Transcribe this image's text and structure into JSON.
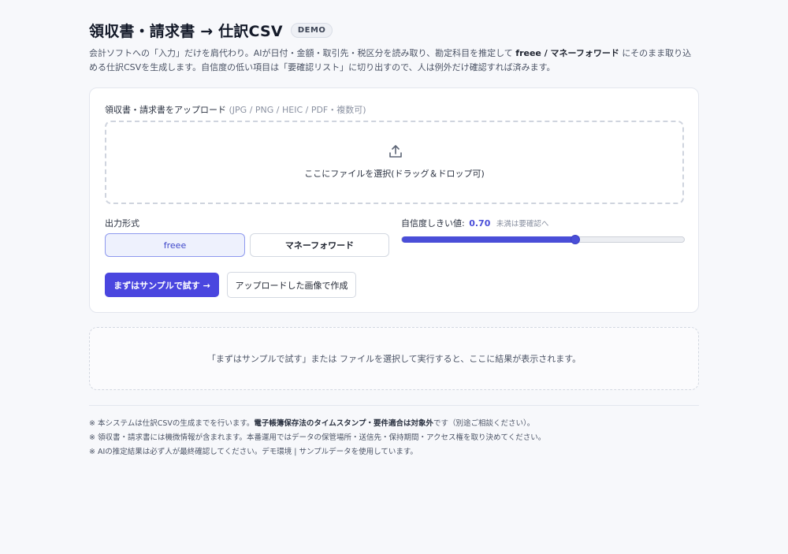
{
  "header": {
    "title": "領収書・請求書 → 仕訳CSV",
    "badge": "DEMO",
    "desc_1": "会計ソフトへの「入力」だけを肩代わり。AIが日付・金額・取引先・税区分を読み取り、勘定科目を推定して ",
    "desc_bold": "freee / マネーフォワード",
    "desc_2": " にそのまま取り込める仕訳CSVを生成します。自信度の低い項目は「要確認リスト」に切り出すので、人は例外だけ確認すれば済みます。"
  },
  "upload": {
    "label": "領収書・請求書をアップロード",
    "hint": "(JPG / PNG / HEIC / PDF・複数可)",
    "icon": "upload-icon",
    "drop_text": "ここにファイルを選択(ドラッグ＆ドロップ可)"
  },
  "format": {
    "label": "出力形式",
    "options": [
      "freee",
      "マネーフォワード"
    ],
    "selected": "freee"
  },
  "confidence": {
    "label": "自信度しきい値:",
    "value_text": "0.70",
    "value": 0.7,
    "min": 0,
    "max": 1,
    "note": "未満は要確認へ",
    "accent": "#4a4ed8"
  },
  "actions": {
    "sample_label": "まずはサンプルで試す →",
    "create_label": "アップロードした画像で作成"
  },
  "result": {
    "placeholder": "「まずはサンプルで試す」または ファイルを選択して実行すると、ここに結果が表示されます。"
  },
  "notes": {
    "n1_a": "※ 本システムは仕訳CSVの生成までを行います。",
    "n1_b": "電子帳簿保存法のタイムスタンプ・要件適合は対象外",
    "n1_c": "です（別途ご相談ください）。",
    "n2": "※ 領収書・請求書には機微情報が含まれます。本番運用ではデータの保管場所・送信先・保持期間・アクセス権を取り決めてください。",
    "n3": "※ AIの推定結果は必ず人が最終確認してください。デモ環境 | サンプルデータを使用しています。"
  }
}
